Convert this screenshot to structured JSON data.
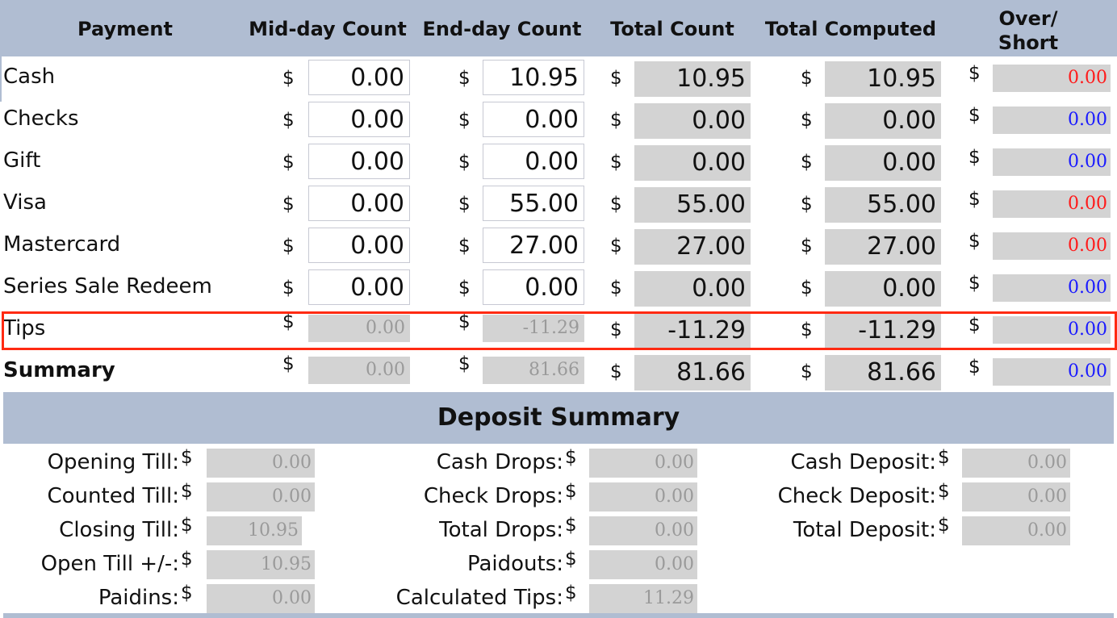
{
  "header": {
    "payment": "Payment",
    "midday": "Mid-day Count",
    "endday": "End-day Count",
    "total_count": "Total Count",
    "total_computed": "Total Computed",
    "over_short_1": "Over/",
    "over_short_2": "Short"
  },
  "currency": "$",
  "rows": [
    {
      "label": "Cash",
      "mid": "0.00",
      "end": "10.95",
      "total": "10.95",
      "computed": "10.95",
      "over": "0.00",
      "over_color": "red"
    },
    {
      "label": "Checks",
      "mid": "0.00",
      "end": "0.00",
      "total": "0.00",
      "computed": "0.00",
      "over": "0.00",
      "over_color": "blue"
    },
    {
      "label": "Gift",
      "mid": "0.00",
      "end": "0.00",
      "total": "0.00",
      "computed": "0.00",
      "over": "0.00",
      "over_color": "blue"
    },
    {
      "label": "Visa",
      "mid": "0.00",
      "end": "55.00",
      "total": "55.00",
      "computed": "55.00",
      "over": "0.00",
      "over_color": "red"
    },
    {
      "label": "Mastercard",
      "mid": "0.00",
      "end": "27.00",
      "total": "27.00",
      "computed": "27.00",
      "over": "0.00",
      "over_color": "red"
    },
    {
      "label": "Series Sale Redeem",
      "mid": "0.00",
      "end": "0.00",
      "total": "0.00",
      "computed": "0.00",
      "over": "0.00",
      "over_color": "blue"
    },
    {
      "label": "Tips",
      "mid": "0.00",
      "end": "-11.29",
      "total": "-11.29",
      "computed": "-11.29",
      "over": "0.00",
      "over_color": "blue"
    },
    {
      "label": "Summary",
      "mid": "0.00",
      "end": "81.66",
      "total": "81.66",
      "computed": "81.66",
      "over": "0.00",
      "over_color": "blue"
    }
  ],
  "deposit": {
    "title": "Deposit Summary",
    "col1": [
      {
        "label": "Opening Till:",
        "value": "0.00"
      },
      {
        "label": "Counted Till:",
        "value": "0.00"
      },
      {
        "label": "Closing Till:",
        "value": "10.95"
      },
      {
        "label": "Open Till +/-:",
        "value": "10.95"
      },
      {
        "label": "Paidins:",
        "value": "0.00"
      }
    ],
    "col2": [
      {
        "label": "Cash Drops:",
        "value": "0.00"
      },
      {
        "label": "Check Drops:",
        "value": "0.00"
      },
      {
        "label": "Total Drops:",
        "value": "0.00"
      },
      {
        "label": "Paidouts:",
        "value": "0.00"
      },
      {
        "label": "Calculated Tips:",
        "value": "11.29"
      }
    ],
    "col3": [
      {
        "label": "Cash Deposit:",
        "value": "0.00"
      },
      {
        "label": "Check Deposit:",
        "value": "0.00"
      },
      {
        "label": "Total Deposit:",
        "value": "0.00"
      }
    ]
  },
  "colors": {
    "header_bg": "#b0bdd2",
    "readonly_bg": "#d3d3d3",
    "over_red": "#ff1a1a",
    "over_blue": "#1a1aff",
    "highlight": "#ff2a12"
  }
}
